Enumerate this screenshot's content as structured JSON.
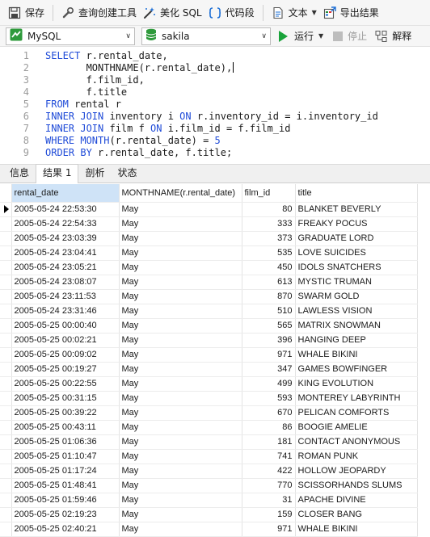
{
  "toolbar": {
    "save": "保存",
    "query_builder": "查询创建工具",
    "beautify_sql": "美化 SQL",
    "code_snippet": "代码段",
    "text": "文本",
    "export_results": "导出结果"
  },
  "connection": {
    "name": "MySQL",
    "database": "sakila"
  },
  "actions": {
    "run": "运行",
    "stop": "停止",
    "explain": "解释"
  },
  "editor": {
    "lines": [
      {
        "n": "1",
        "parts": [
          [
            "kw",
            "SELECT"
          ],
          [
            "tx",
            " r.rental_date,"
          ]
        ]
      },
      {
        "n": "2",
        "parts": [
          [
            "tx",
            "       MONTHNAME(r.rental_date),"
          ]
        ]
      },
      {
        "n": "3",
        "parts": [
          [
            "tx",
            "       f.film_id,"
          ]
        ]
      },
      {
        "n": "4",
        "parts": [
          [
            "tx",
            "       f.title"
          ]
        ]
      },
      {
        "n": "5",
        "parts": [
          [
            "kw",
            "FROM"
          ],
          [
            "tx",
            " rental r"
          ]
        ]
      },
      {
        "n": "6",
        "parts": [
          [
            "kw",
            "INNER JOIN"
          ],
          [
            "tx",
            " inventory i "
          ],
          [
            "kw",
            "ON"
          ],
          [
            "tx",
            " r.inventory_id = i.inventory_id"
          ]
        ]
      },
      {
        "n": "7",
        "parts": [
          [
            "kw",
            "INNER JOIN"
          ],
          [
            "tx",
            " film f "
          ],
          [
            "kw",
            "ON"
          ],
          [
            "tx",
            " i.film_id = f.film_id"
          ]
        ]
      },
      {
        "n": "8",
        "parts": [
          [
            "kw",
            "WHERE MONTH"
          ],
          [
            "tx",
            "(r.rental_date) = "
          ],
          [
            "num",
            "5"
          ]
        ]
      },
      {
        "n": "9",
        "parts": [
          [
            "kw",
            "ORDER BY"
          ],
          [
            "tx",
            " r.rental_date, f.title;"
          ]
        ]
      }
    ]
  },
  "tabs": [
    "信息",
    "结果 1",
    "剖析",
    "状态"
  ],
  "active_tab": 1,
  "grid": {
    "columns": [
      "rental_date",
      "MONTHNAME(r.rental_date)",
      "film_id",
      "title"
    ],
    "rows": [
      [
        "2005-05-24 22:53:30",
        "May",
        "80",
        "BLANKET BEVERLY"
      ],
      [
        "2005-05-24 22:54:33",
        "May",
        "333",
        "FREAKY POCUS"
      ],
      [
        "2005-05-24 23:03:39",
        "May",
        "373",
        "GRADUATE LORD"
      ],
      [
        "2005-05-24 23:04:41",
        "May",
        "535",
        "LOVE SUICIDES"
      ],
      [
        "2005-05-24 23:05:21",
        "May",
        "450",
        "IDOLS SNATCHERS"
      ],
      [
        "2005-05-24 23:08:07",
        "May",
        "613",
        "MYSTIC TRUMAN"
      ],
      [
        "2005-05-24 23:11:53",
        "May",
        "870",
        "SWARM GOLD"
      ],
      [
        "2005-05-24 23:31:46",
        "May",
        "510",
        "LAWLESS VISION"
      ],
      [
        "2005-05-25 00:00:40",
        "May",
        "565",
        "MATRIX SNOWMAN"
      ],
      [
        "2005-05-25 00:02:21",
        "May",
        "396",
        "HANGING DEEP"
      ],
      [
        "2005-05-25 00:09:02",
        "May",
        "971",
        "WHALE BIKINI"
      ],
      [
        "2005-05-25 00:19:27",
        "May",
        "347",
        "GAMES BOWFINGER"
      ],
      [
        "2005-05-25 00:22:55",
        "May",
        "499",
        "KING EVOLUTION"
      ],
      [
        "2005-05-25 00:31:15",
        "May",
        "593",
        "MONTEREY LABYRINTH"
      ],
      [
        "2005-05-25 00:39:22",
        "May",
        "670",
        "PELICAN COMFORTS"
      ],
      [
        "2005-05-25 00:43:11",
        "May",
        "86",
        "BOOGIE AMELIE"
      ],
      [
        "2005-05-25 01:06:36",
        "May",
        "181",
        "CONTACT ANONYMOUS"
      ],
      [
        "2005-05-25 01:10:47",
        "May",
        "741",
        "ROMAN PUNK"
      ],
      [
        "2005-05-25 01:17:24",
        "May",
        "422",
        "HOLLOW JEOPARDY"
      ],
      [
        "2005-05-25 01:48:41",
        "May",
        "770",
        "SCISSORHANDS SLUMS"
      ],
      [
        "2005-05-25 01:59:46",
        "May",
        "31",
        "APACHE DIVINE"
      ],
      [
        "2005-05-25 02:19:23",
        "May",
        "159",
        "CLOSER BANG"
      ],
      [
        "2005-05-25 02:40:21",
        "May",
        "971",
        "WHALE BIKINI"
      ]
    ]
  }
}
